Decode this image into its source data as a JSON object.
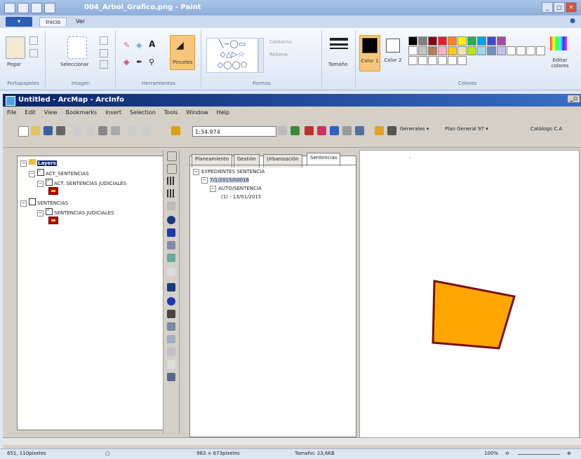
{
  "paint": {
    "window_title": "004_Arbol_Grafico.png - Paint",
    "tabs": [
      "Inicio",
      "Ver"
    ],
    "groups": {
      "clipboard": {
        "caption": "Portapapeles",
        "paste": "Pegar"
      },
      "image": {
        "caption": "Imagen",
        "select": "Seleccionar"
      },
      "tools": {
        "caption": "Herramientas",
        "brushes": "Pinceles"
      },
      "shapes": {
        "caption": "Formas",
        "outline": "Contorno",
        "fill": "Relleno"
      },
      "size": {
        "label": "Tamaño"
      },
      "colors": {
        "caption": "Colores",
        "color1": "Color 1",
        "color2": "Color 2",
        "edit": "Editar colores"
      }
    },
    "palette": [
      "#000000",
      "#7f7f7f",
      "#880015",
      "#ed1c24",
      "#ff7f27",
      "#fff200",
      "#22b14c",
      "#00a2e8",
      "#3f48cc",
      "#a349a4",
      "#ffffff",
      "#c3c3c3",
      "#b97a57",
      "#ffaec9",
      "#ffc90e",
      "#efe4b0",
      "#b5e61d",
      "#99d9ea",
      "#7092be",
      "#c8bfe7"
    ],
    "status": {
      "coords": "651, 110píxeles",
      "dimensions": "983 × 673píxeles",
      "filesize": "Tamaño: 23,6KB",
      "zoom": "100%"
    }
  },
  "arcmap": {
    "window_title": "Untitled - ArcMap - ArcInfo",
    "menu": [
      "File",
      "Edit",
      "View",
      "Bookmarks",
      "Insert",
      "Selection",
      "Tools",
      "Window",
      "Help"
    ],
    "scale": "1:34.974",
    "dropdowns": {
      "generales": "Generales",
      "plan": "Plan General 97",
      "catalogo": "Catálogo C.A"
    },
    "toc": {
      "root": "Layers",
      "items": [
        {
          "label": "ACT_SENTENCIAS",
          "checked": true
        },
        {
          "label": "ACT. SENTENCIAS JUDICIALES",
          "checked": true
        },
        {
          "label": "SENTENCIAS",
          "checked": false
        },
        {
          "label": "SENTENCIAS JUDICIALES",
          "checked": true
        }
      ]
    },
    "panel_tabs": [
      "Planeamiento",
      "Gestión",
      "Urbanización",
      "Sentencias"
    ],
    "sentencias_tree": {
      "root": "EXPEDIENTES SENTENCIA",
      "case": "7/1/2015/00016",
      "node": "AUTO/SENTENCIA",
      "leaf": "(1) - 13/01/2015"
    },
    "polygon_fill": "#ffa500",
    "polygon_stroke": "#7a1010"
  }
}
